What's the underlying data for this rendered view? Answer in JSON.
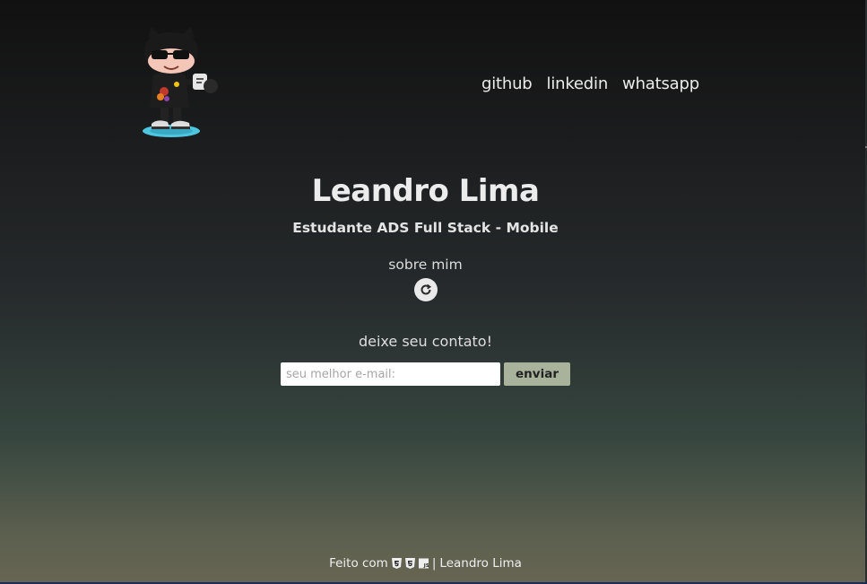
{
  "nav": {
    "items": [
      {
        "label": "github"
      },
      {
        "label": "linkedin"
      },
      {
        "label": "whatsapp"
      }
    ]
  },
  "hero": {
    "name": "Leandro Lima",
    "subtitle": "Estudante ADS Full Stack - Mobile",
    "about_label": "sobre mim"
  },
  "contact": {
    "title": "deixe seu contato!",
    "email_placeholder": "seu melhor e-mail:",
    "submit_label": "enviar"
  },
  "footer": {
    "prefix": "Feito com",
    "separator": "|",
    "author": "Leandro Lima",
    "icons": [
      "html5-icon",
      "css3-icon",
      "javascript-icon"
    ]
  },
  "colors": {
    "accent_button": "#a9b39b",
    "text": "#ececec"
  }
}
